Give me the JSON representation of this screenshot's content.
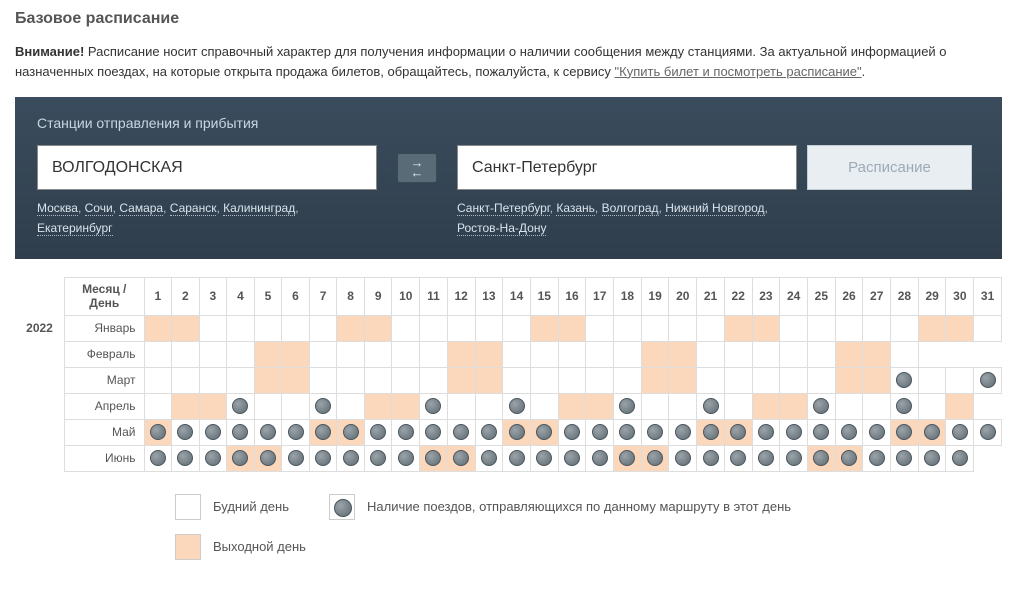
{
  "title": "Базовое расписание",
  "notice": {
    "strong": "Внимание!",
    "text": " Расписание носит справочный характер для получения информации о наличии сообщения между станциями. За актуальной информацией о назначенных поездах, на которые открыта продажа билетов, обращайтесь, пожалуйста, к сервису ",
    "link": "\"Купить билет и посмотреть расписание\"",
    "after": "."
  },
  "search": {
    "heading": "Станции отправления и прибытия",
    "from_value": "ВОЛГОДОНСКАЯ",
    "to_value": "Санкт-Петербург",
    "button": "Расписание",
    "tooltip_swap": "Поменять",
    "quick_from": [
      "Москва",
      "Сочи",
      "Самара",
      "Саранск",
      "Калининград",
      "Екатеринбург"
    ],
    "quick_to": [
      "Санкт-Петербург",
      "Казань",
      "Волгоград",
      "Нижний Новгород",
      "Ростов-На-Дону"
    ]
  },
  "schedule": {
    "header_month": "Месяц / День",
    "year": "2022",
    "days": [
      "1",
      "2",
      "3",
      "4",
      "5",
      "6",
      "7",
      "8",
      "9",
      "10",
      "11",
      "12",
      "13",
      "14",
      "15",
      "16",
      "17",
      "18",
      "19",
      "20",
      "21",
      "22",
      "23",
      "24",
      "25",
      "26",
      "27",
      "28",
      "29",
      "30",
      "31"
    ],
    "months": [
      {
        "name": "Январь",
        "days": 31,
        "weekend": [
          1,
          2,
          8,
          9,
          15,
          16,
          22,
          23,
          29,
          30
        ],
        "train": []
      },
      {
        "name": "Февраль",
        "days": 28,
        "weekend": [
          5,
          6,
          12,
          13,
          19,
          20,
          26,
          27
        ],
        "train": []
      },
      {
        "name": "Март",
        "days": 31,
        "weekend": [
          5,
          6,
          12,
          13,
          19,
          20,
          26,
          27
        ],
        "train": [
          28,
          31
        ]
      },
      {
        "name": "Апрель",
        "days": 30,
        "weekend": [
          2,
          3,
          9,
          10,
          16,
          17,
          23,
          24,
          30
        ],
        "train": [
          4,
          7,
          11,
          14,
          18,
          21,
          25,
          28
        ]
      },
      {
        "name": "Май",
        "days": 31,
        "weekend": [
          1,
          7,
          8,
          14,
          15,
          21,
          22,
          28,
          29
        ],
        "train": [
          1,
          2,
          3,
          4,
          5,
          6,
          7,
          8,
          9,
          10,
          11,
          12,
          13,
          14,
          15,
          16,
          17,
          18,
          19,
          20,
          21,
          22,
          23,
          24,
          25,
          26,
          27,
          28,
          29,
          30,
          31
        ]
      },
      {
        "name": "Июнь",
        "days": 30,
        "weekend": [
          4,
          5,
          11,
          12,
          18,
          19,
          25,
          26
        ],
        "train": [
          1,
          2,
          3,
          4,
          5,
          6,
          7,
          8,
          9,
          10,
          11,
          12,
          13,
          14,
          15,
          16,
          17,
          18,
          19,
          20,
          21,
          22,
          23,
          24,
          25,
          26,
          27,
          28,
          29,
          30
        ]
      }
    ]
  },
  "legend": {
    "work": "Будний день",
    "weekend": "Выходной день",
    "train": "Наличие поездов, отправляющихся по данному маршруту в этот день"
  }
}
